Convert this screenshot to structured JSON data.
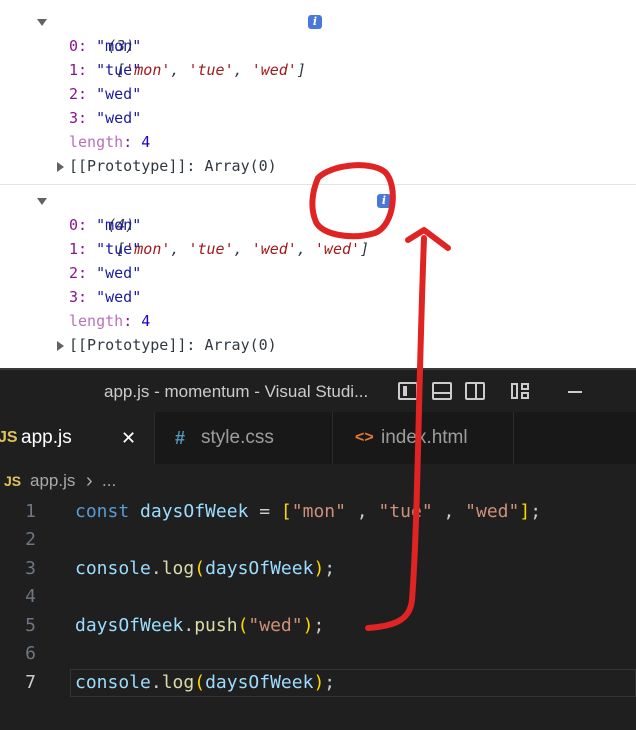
{
  "console": {
    "groups": [
      {
        "count": "(3)",
        "preview": [
          "'mon'",
          "'tue'",
          "'wed'"
        ],
        "entries": [
          {
            "key": "0",
            "value": "\"mon\""
          },
          {
            "key": "1",
            "value": "\"tue\""
          },
          {
            "key": "2",
            "value": "\"wed\""
          },
          {
            "key": "3",
            "value": "\"wed\""
          }
        ],
        "length_key": "length",
        "length_value": "4",
        "proto_key": "[[Prototype]]",
        "proto_value": "Array(0)"
      },
      {
        "count": "(4)",
        "preview": [
          "'mon'",
          "'tue'",
          "'wed'",
          "'wed'"
        ],
        "entries": [
          {
            "key": "0",
            "value": "\"mon\""
          },
          {
            "key": "1",
            "value": "\"tue\""
          },
          {
            "key": "2",
            "value": "\"wed\""
          },
          {
            "key": "3",
            "value": "\"wed\""
          }
        ],
        "length_key": "length",
        "length_value": "4",
        "proto_key": "[[Prototype]]",
        "proto_value": "Array(0)"
      }
    ],
    "info_badge": "i"
  },
  "vscode": {
    "title": "app.js - momentum - Visual Studi...",
    "tabs": [
      {
        "icon": "JS",
        "label": "app.js",
        "close": "✕"
      },
      {
        "icon": "#",
        "label": "style.css"
      },
      {
        "icon": "<>",
        "label": "index.html"
      }
    ],
    "breadcrumb": {
      "icon": "JS",
      "file": "app.js",
      "sep": "›",
      "more": "..."
    },
    "lines": [
      {
        "n": "1"
      },
      {
        "n": "2"
      },
      {
        "n": "3"
      },
      {
        "n": "4"
      },
      {
        "n": "5"
      },
      {
        "n": "6"
      },
      {
        "n": "7"
      }
    ],
    "code": {
      "l1_const": "const",
      "l1_var": "daysOfWeek",
      "l1_eq": " = ",
      "l1_open": "[",
      "l1_s1": "\"mon\"",
      "l1_c1": " , ",
      "l1_s2": "\"tue\"",
      "l1_c2": " , ",
      "l1_s3": "\"wed\"",
      "l1_close": "]",
      "l1_semi": ";",
      "console": "console",
      "dot": ".",
      "log": "log",
      "paren_open": "(",
      "paren_close": ")",
      "semi": ";",
      "arg": "daysOfWeek",
      "l5_obj": "daysOfWeek",
      "l5_push": "push",
      "l5_str": "\"wed\""
    }
  },
  "colors": {
    "annotation": "#e02424",
    "vscode_bg": "#1f1f1f",
    "console_string": "#a4191b",
    "console_key": "#881391"
  }
}
